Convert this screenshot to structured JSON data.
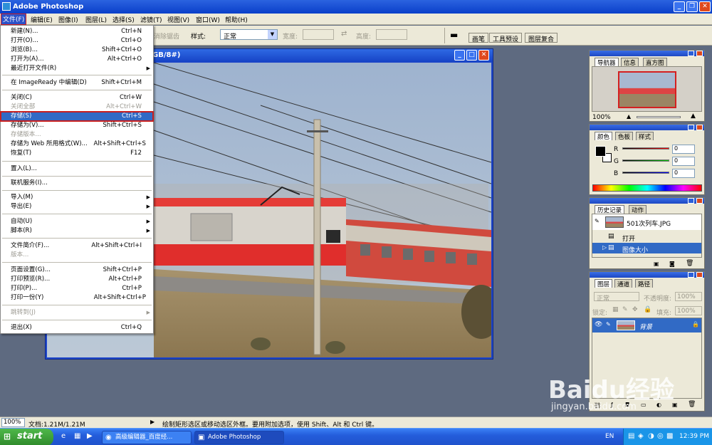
{
  "app": {
    "title": "Adobe Photoshop"
  },
  "menubar": {
    "items": [
      "文件(F)",
      "编辑(E)",
      "图像(I)",
      "图层(L)",
      "选择(S)",
      "滤镜(T)",
      "视图(V)",
      "窗口(W)",
      "帮助(H)"
    ]
  },
  "options": {
    "feather_fragment": "消除锯齿",
    "style_label": "样式:",
    "style_value": "正常",
    "width_label": "宽度:",
    "height_label": "高度:",
    "tabs": [
      "画笔",
      "工具预设",
      "图层复合"
    ]
  },
  "document": {
    "title_fragment": "GB/8#)"
  },
  "file_menu": {
    "items": [
      {
        "label": "新建(N)...",
        "shortcut": "Ctrl+N"
      },
      {
        "label": "打开(O)...",
        "shortcut": "Ctrl+O"
      },
      {
        "label": "浏览(B)...",
        "shortcut": "Shift+Ctrl+O"
      },
      {
        "label": "打开为(A)...",
        "shortcut": "Alt+Ctrl+O"
      },
      {
        "label": "最近打开文件(R)",
        "shortcut": ""
      },
      {
        "label": "在 ImageReady 中编辑(D)",
        "shortcut": "Shift+Ctrl+M"
      },
      {
        "label": "关闭(C)",
        "shortcut": "Ctrl+W"
      },
      {
        "label": "关闭全部",
        "shortcut": "Alt+Ctrl+W"
      },
      {
        "label": "存储(S)",
        "shortcut": "Ctrl+S"
      },
      {
        "label": "存储为(V)...",
        "shortcut": "Shift+Ctrl+S"
      },
      {
        "label": "存储版本...",
        "shortcut": ""
      },
      {
        "label": "存储为 Web 所用格式(W)...",
        "shortcut": "Alt+Shift+Ctrl+S"
      },
      {
        "label": "恢复(T)",
        "shortcut": "F12"
      },
      {
        "label": "置入(L)...",
        "shortcut": ""
      },
      {
        "label": "联机服务(I)...",
        "shortcut": ""
      },
      {
        "label": "导入(M)",
        "shortcut": ""
      },
      {
        "label": "导出(E)",
        "shortcut": ""
      },
      {
        "label": "自动(U)",
        "shortcut": ""
      },
      {
        "label": "脚本(R)",
        "shortcut": ""
      },
      {
        "label": "文件简介(F)...",
        "shortcut": "Alt+Shift+Ctrl+I"
      },
      {
        "label": "版本...",
        "shortcut": ""
      },
      {
        "label": "页面设置(G)...",
        "shortcut": "Shift+Ctrl+P"
      },
      {
        "label": "打印预览(R)...",
        "shortcut": "Alt+Ctrl+P"
      },
      {
        "label": "打印(P)...",
        "shortcut": "Ctrl+P"
      },
      {
        "label": "打印一份(Y)",
        "shortcut": "Alt+Shift+Ctrl+P"
      },
      {
        "label": "跳转到(J)",
        "shortcut": ""
      },
      {
        "label": "退出(X)",
        "shortcut": "Ctrl+Q"
      }
    ]
  },
  "navigator": {
    "tabs": [
      "导航器",
      "信息",
      "直方图"
    ],
    "zoom": "100%"
  },
  "color": {
    "tabs": [
      "颜色",
      "色板",
      "样式"
    ],
    "r_label": "R",
    "g_label": "G",
    "b_label": "B",
    "r": "0",
    "g": "0",
    "b": "0"
  },
  "history": {
    "tabs": [
      "历史记录",
      "动作"
    ],
    "snapshot": "501次列车.JPG",
    "states": [
      "打开",
      "图像大小"
    ]
  },
  "layers": {
    "tabs": [
      "图层",
      "通道",
      "路径"
    ],
    "blend_mode": "正常",
    "opacity_label": "不透明度:",
    "opacity": "100%",
    "lock_label": "锁定:",
    "fill_label": "填充:",
    "fill": "100%",
    "layer_name": "背景"
  },
  "status": {
    "zoom": "100%",
    "doc": "文档:1.21M/1.21M",
    "hint": "绘制矩形选区或移动选区外框。要用附加选项，使用 Shift、Alt 和 Ctrl 键。"
  },
  "taskbar": {
    "start": "start",
    "tasks": [
      "高级编辑器_百度经...",
      "Adobe Photoshop"
    ],
    "lang": "EN",
    "time": "12:39 PM"
  },
  "watermark": {
    "brand": "Baidu经验",
    "url": "jingyan.baidu.com"
  }
}
